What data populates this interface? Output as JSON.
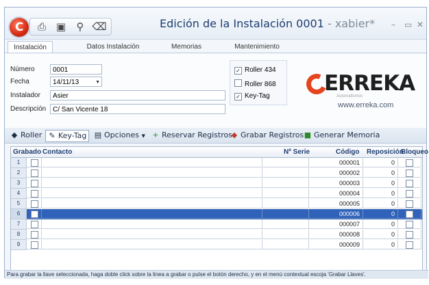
{
  "window": {
    "title": "Edición de la Instalación 0001",
    "title_user": " - xabier*",
    "minimize": "–",
    "maximize": "▭",
    "close": "✕"
  },
  "qat": {
    "icons": [
      "print-preview-icon",
      "save-icon",
      "search-icon",
      "delete-icon"
    ]
  },
  "tabs": [
    {
      "label": "Instalación",
      "active": true
    },
    {
      "label": "Datos Instalación",
      "active": false
    },
    {
      "label": "Memorias",
      "active": false
    },
    {
      "label": "Mantenimiento",
      "active": false
    }
  ],
  "form": {
    "numero_label": "Número",
    "numero_value": "0001",
    "fecha_label": "Fecha",
    "fecha_value": "14/11/13",
    "instalador_label": "Instalador",
    "instalador_value": "Asier",
    "descripcion_label": "Descripción",
    "descripcion_value": "C/ San Vicente 18"
  },
  "options": [
    {
      "label": "Roller 434",
      "checked": true
    },
    {
      "label": "Roller 868",
      "checked": false
    },
    {
      "label": "Key-Tag",
      "checked": true
    }
  ],
  "brand": {
    "word": "ERREKA",
    "sub": "Automatismos",
    "url": "www.erreka.com",
    "color": "#e4451f"
  },
  "toolbar": {
    "roller": "Roller",
    "keytag": "Key-Tag",
    "opciones": "Opciones",
    "reservar": "Reservar Registros",
    "grabar": "Grabar Registros",
    "generar": "Generar Memoria"
  },
  "grid": {
    "headers": {
      "grabado": "Grabado",
      "contacto": "Contacto",
      "serie": "Nº Serie",
      "codigo": "Código",
      "reposicion": "Reposición",
      "bloqueo": "Bloqueo"
    },
    "selected_row": 6,
    "rows": [
      {
        "n": "1",
        "codigo": "000001",
        "reposicion": "0"
      },
      {
        "n": "2",
        "codigo": "000002",
        "reposicion": "0"
      },
      {
        "n": "3",
        "codigo": "000003",
        "reposicion": "0"
      },
      {
        "n": "4",
        "codigo": "000004",
        "reposicion": "0"
      },
      {
        "n": "5",
        "codigo": "000005",
        "reposicion": "0"
      },
      {
        "n": "6",
        "codigo": "000006",
        "reposicion": "0"
      },
      {
        "n": "7",
        "codigo": "000007",
        "reposicion": "0"
      },
      {
        "n": "8",
        "codigo": "000008",
        "reposicion": "0"
      },
      {
        "n": "9",
        "codigo": "000009",
        "reposicion": "0"
      }
    ]
  },
  "status": "Para grabar la llave seleccionada, haga doble click sobre la linea a grabar o pulse el botón derecho, y en el menú contextual escoja 'Grabar Llaves'."
}
